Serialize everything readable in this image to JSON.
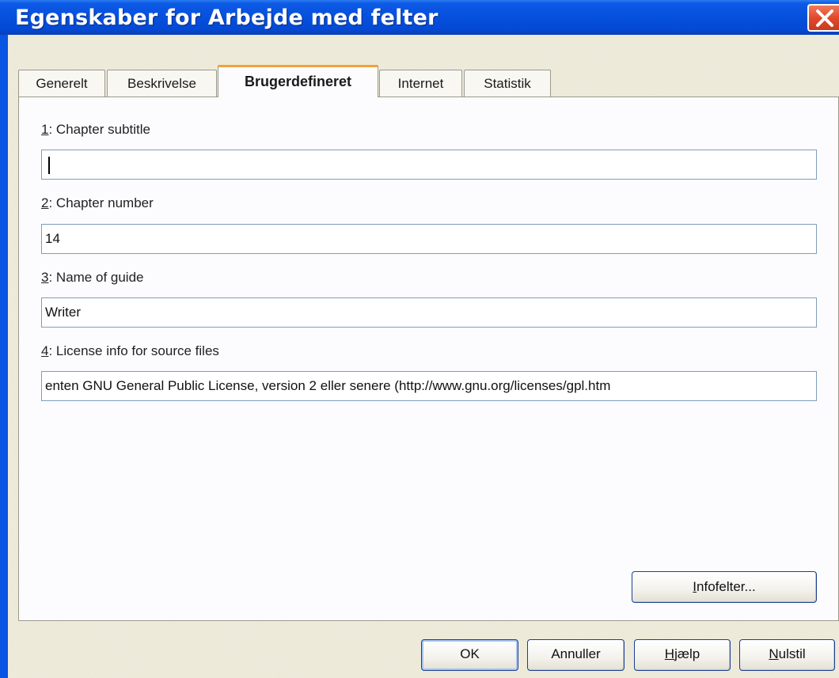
{
  "window": {
    "title": "Egenskaber for Arbejde med felter"
  },
  "tabs": [
    {
      "label": "Generelt"
    },
    {
      "label": "Beskrivelse"
    },
    {
      "label": "Brugerdefineret"
    },
    {
      "label": "Internet"
    },
    {
      "label": "Statistik"
    }
  ],
  "fields": [
    {
      "num": "1",
      "label": ": Chapter subtitle",
      "value": ""
    },
    {
      "num": "2",
      "label": ": Chapter number",
      "value": "14"
    },
    {
      "num": "3",
      "label": ": Name of guide",
      "value": "Writer"
    },
    {
      "num": "4",
      "label": ": License info for source files",
      "value": "enten GNU General Public License, version 2 eller senere (http://www.gnu.org/licenses/gpl.htm"
    }
  ],
  "buttons": {
    "infofelter_prefix": "I",
    "infofelter_rest": "nfofelter...",
    "ok": "OK",
    "annuller": "Annuller",
    "hjaelp_prefix": "H",
    "hjaelp_rest": "jælp",
    "nulstil_prefix": "N",
    "nulstil_rest": "ulstil"
  }
}
